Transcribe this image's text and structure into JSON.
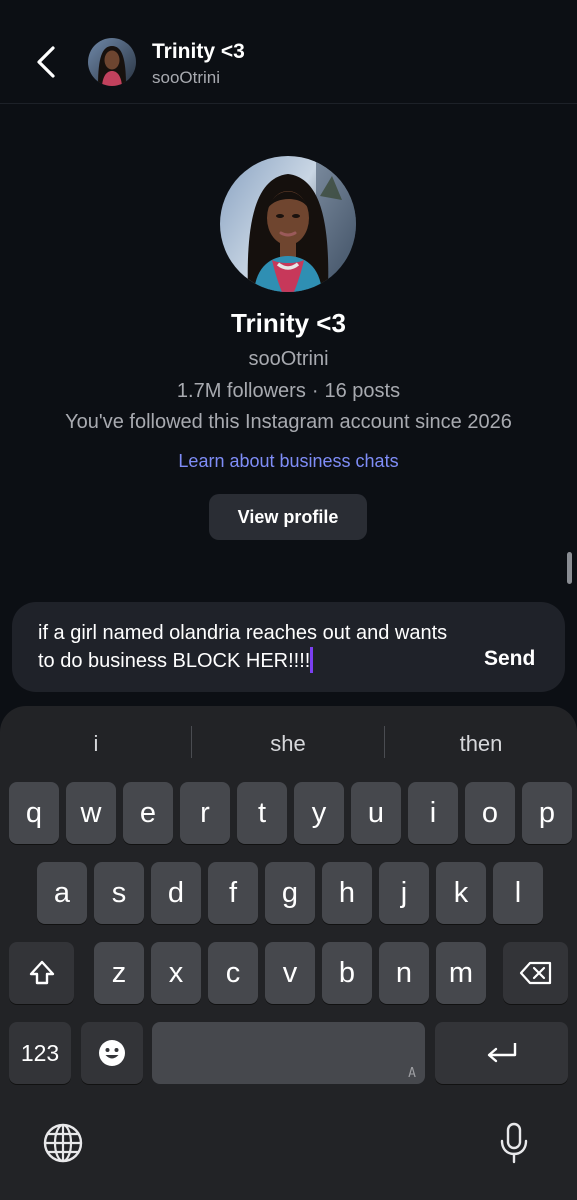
{
  "header": {
    "name": "Trinity <3",
    "handle": "sooOtrini"
  },
  "profile": {
    "name": "Trinity <3",
    "handle": "sooOtrini",
    "followers": "1.7M followers",
    "separator": "·",
    "posts": "16 posts",
    "since": "You've followed this Instagram account since 2026",
    "business_link": "Learn about business chats",
    "view_profile_label": "View profile"
  },
  "composer": {
    "text": "if a girl named olandria reaches out and wants to do business BLOCK HER!!!!",
    "send_label": "Send"
  },
  "keyboard": {
    "suggestions": [
      "i",
      "she",
      "then"
    ],
    "row1": [
      "q",
      "w",
      "e",
      "r",
      "t",
      "y",
      "u",
      "i",
      "o",
      "p"
    ],
    "row2": [
      "a",
      "s",
      "d",
      "f",
      "g",
      "h",
      "j",
      "k",
      "l"
    ],
    "row3": [
      "z",
      "x",
      "c",
      "v",
      "b",
      "n",
      "m"
    ],
    "numbers_label": "123",
    "space_hint": "A"
  },
  "colors": {
    "background": "#0c0f14",
    "link": "#7f8df7",
    "caret": "#7b3ff2",
    "key": "#46484d",
    "keyboard_bg": "#222326"
  },
  "icons": {
    "back": "chevron-left-icon",
    "shift": "shift-icon",
    "backspace": "backspace-icon",
    "emoji": "emoji-icon",
    "return": "return-icon",
    "globe": "globe-icon",
    "mic": "microphone-icon"
  }
}
